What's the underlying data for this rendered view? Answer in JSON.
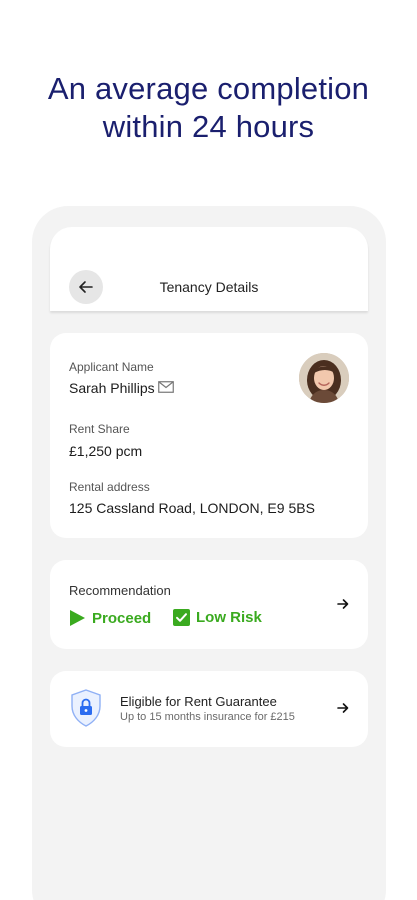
{
  "headline": {
    "line1": "An average completion",
    "line2": "within 24 hours"
  },
  "app_bar": {
    "title": "Tenancy Details",
    "back_icon": "arrow-left-icon"
  },
  "details": {
    "applicant_label": "Applicant Name",
    "applicant_name": "Sarah Phillips",
    "rent_share_label": "Rent Share",
    "rent_share_value": "£1,250 pcm",
    "address_label": "Rental address",
    "address_value": "125 Cassland Road, LONDON, E9 5BS"
  },
  "recommendation": {
    "label": "Recommendation",
    "proceed_label": "Proceed",
    "risk_label": "Low Risk"
  },
  "guarantee": {
    "title": "Eligible for Rent Guarantee",
    "subtitle": "Up to 15 months insurance for £215"
  },
  "colors": {
    "headline": "#1a1f6e",
    "success_green": "#3aaa1f",
    "shield_blue": "#2b6cf0",
    "phone_bg": "#f3f3f3"
  }
}
